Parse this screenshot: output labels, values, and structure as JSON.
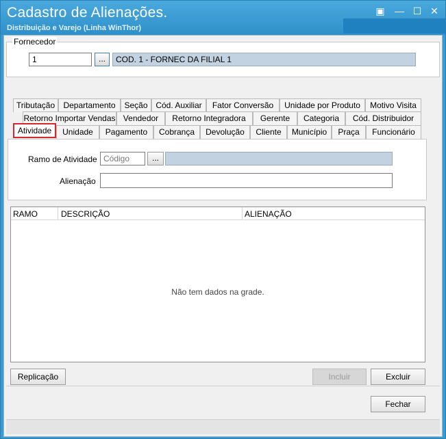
{
  "window": {
    "title": "Cadastro de Alienações.",
    "subtitle": "Distribuição e Varejo (Linha WinThor)",
    "controls": {
      "restore": "▣",
      "minimize": "—",
      "maximize": "☐",
      "close": "✕"
    }
  },
  "fornecedor": {
    "group_label": "Fornecedor",
    "code_value": "1",
    "lookup_label": "...",
    "name_value": "COD. 1 - FORNEC DA FILIAL 1"
  },
  "tabs": {
    "row1": [
      "Tributação",
      "Departamento",
      "Seção",
      "Cód. Auxiliar",
      "Fator Conversão",
      "Unidade por Produto",
      "Motivo Visita"
    ],
    "row2": [
      "Retorno Importar Vendas",
      "Vendedor",
      "Retorno Integradora",
      "Gerente",
      "Categoria",
      "Cód. Distribuidor"
    ],
    "row3": [
      "Atividade",
      "Unidade",
      "Pagamento",
      "Cobrança",
      "Devolução",
      "Cliente",
      "Município",
      "Praça",
      "Funcionário"
    ],
    "active": "Atividade"
  },
  "atividade_form": {
    "ramo_label": "Ramo de Atividade",
    "ramo_code_placeholder": "Código",
    "ramo_lookup_label": "...",
    "ramo_description_value": "",
    "alienacao_label": "Alienação",
    "alienacao_value": ""
  },
  "grid": {
    "columns": [
      "RAMO",
      "DESCRIÇÃO",
      "ALIENAÇÃO"
    ],
    "rows": [],
    "empty_message": "Não tem dados na grade."
  },
  "actions": {
    "replicacao": "Replicação",
    "incluir": "Incluir",
    "excluir": "Excluir",
    "fechar": "Fechar"
  }
}
